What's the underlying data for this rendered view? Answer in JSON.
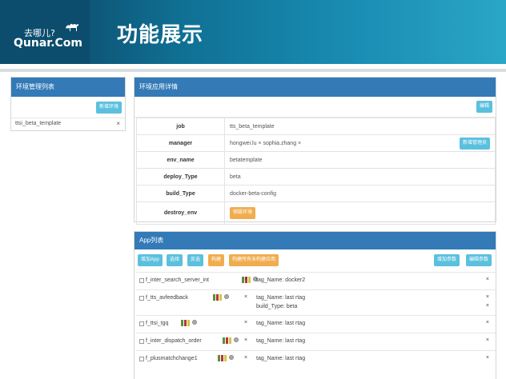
{
  "header": {
    "logo_cn": "去哪儿?",
    "logo_en": "Qunar.Com",
    "title": "功能展示"
  },
  "left_panel": {
    "title": "环境管理列表",
    "add_button": "新增环境",
    "items": [
      {
        "name": "ttsi_beta_template",
        "remove": "×"
      }
    ]
  },
  "detail_panel": {
    "title": "环境应用详情",
    "edit_button": "编辑",
    "fields": {
      "job_label": "job",
      "job_value": "tts_beta_template",
      "manager_label": "manager",
      "manager_value": "hongwei.lu ×  sophia.zhang ×",
      "manager_button": "新增管理员",
      "env_name_label": "env_name",
      "env_name_value": "betatemplate",
      "deploy_type_label": "deploy_Type",
      "deploy_type_value": "beta",
      "build_type_label": "build_Type",
      "build_type_value": "docker-beta-config",
      "destroy_env_label": "destroy_env",
      "destroy_button": "销毁环境"
    }
  },
  "app_panel": {
    "title": "App列表",
    "buttons": {
      "add_app": "增加App",
      "select": "选择",
      "deploy": "反选",
      "build": "构建",
      "build_all": "构建所有未构建应用",
      "add_param": "增加参数",
      "edit_param": "编辑参数"
    },
    "rows": [
      {
        "name": "f_inter_search_server_int",
        "x": "×",
        "tags": [
          "tag_Name: docker2"
        ],
        "tag_x": [
          "×"
        ]
      },
      {
        "name": "f_tts_avfeedback",
        "x": "×",
        "tags": [
          "tag_Name: last rtag",
          "build_Type: beta"
        ],
        "tag_x": [
          "×",
          "×"
        ]
      },
      {
        "name": "f_ttsi_tgq",
        "x": "×",
        "tags": [
          "tag_Name: last rtag"
        ],
        "tag_x": [
          "×"
        ]
      },
      {
        "name": "f_inter_dispatch_order",
        "x": "×",
        "tags": [
          "tag_Name: last rtag"
        ],
        "tag_x": [
          "×"
        ]
      },
      {
        "name": "f_plusmatchchange1",
        "x": "×",
        "tags": [
          "tag_Name: last rtag"
        ],
        "tag_x": [
          "×"
        ]
      }
    ]
  },
  "colors": {
    "panel_head": "#337ab7",
    "info_button": "#5bc0de",
    "warning_button": "#f0ad4e"
  }
}
